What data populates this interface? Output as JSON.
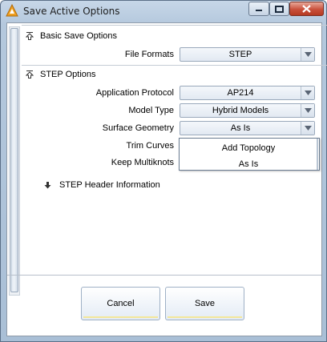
{
  "window": {
    "title": "Save Active Options",
    "icon": "app-logo-icon",
    "controls": [
      "minimize-icon",
      "maximize-icon",
      "close-icon"
    ]
  },
  "sections": {
    "basic": {
      "title": "Basic Save Options",
      "file_formats_label": "File Formats",
      "file_formats_value": "STEP"
    },
    "step": {
      "title": "STEP Options",
      "application_protocol_label": "Application Protocol",
      "application_protocol_value": "AP214",
      "model_type_label": "Model Type",
      "model_type_value": "Hybrid Models",
      "surface_geometry_label": "Surface Geometry",
      "surface_geometry_value": "As Is",
      "trim_curves_label": "Trim Curves",
      "keep_multiknots_label": "Keep Multiknots",
      "header_info_label": "STEP Header Information"
    }
  },
  "dropdown": {
    "options": [
      "Add Topology",
      "As Is"
    ]
  },
  "buttons": {
    "cancel": "Cancel",
    "save": "Save"
  },
  "colors": {
    "button_accent": "#f3e79a",
    "close_button": "#c9503b"
  }
}
